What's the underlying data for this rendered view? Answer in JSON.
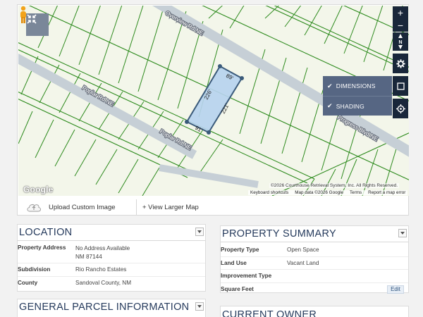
{
  "map": {
    "roads": [
      {
        "label": "Overview Rd NE"
      },
      {
        "label": "Poplar Rd NE"
      },
      {
        "label": "Poplar Rd NE"
      },
      {
        "label": "Progress Blvd NE"
      }
    ],
    "parcel": {
      "dimensions": [
        "89'",
        "226'",
        "221'",
        "91'"
      ]
    },
    "controls": {
      "zoom_in": "+",
      "zoom_out": "−",
      "compass": "N"
    },
    "layers": [
      {
        "label": "DIMENSIONS",
        "checked": true
      },
      {
        "label": "SHADING",
        "checked": true
      }
    ],
    "google_logo": "Google",
    "attribution": "©2026 Courthouse Retrieval System, Inc. All Rights Reserved.",
    "footer_links": [
      "Keyboard shortcuts",
      "Map data ©2026 Google",
      "Terms",
      "Report a map error"
    ],
    "colors": {
      "lot_lines": "#2e8b1e",
      "road": "#c6cfd6",
      "parcel_fill": "#b7d3ee",
      "parcel_outline": "#3a5a7a",
      "control_bg": "#19273a"
    }
  },
  "map_actions": {
    "upload": "Upload Custom Image",
    "view_larger": "+ View Larger Map"
  },
  "location": {
    "title": "LOCATION",
    "rows": [
      {
        "label": "Property Address",
        "value_line1": "No Address Available",
        "value_line2": "NM 87144"
      },
      {
        "label": "Subdivision",
        "value": "Rio Rancho Estates"
      },
      {
        "label": "County",
        "value": "Sandoval County, NM"
      }
    ]
  },
  "summary": {
    "title": "PROPERTY SUMMARY",
    "rows": [
      {
        "label": "Property Type",
        "value": "Open Space"
      },
      {
        "label": "Land Use",
        "value": "Vacant Land"
      },
      {
        "label": "Improvement Type",
        "value": ""
      },
      {
        "label": "Square Feet",
        "value": "",
        "action": "Edit"
      }
    ]
  },
  "general": {
    "title": "GENERAL PARCEL INFORMATION"
  },
  "owner": {
    "title": "CURRENT OWNER"
  }
}
